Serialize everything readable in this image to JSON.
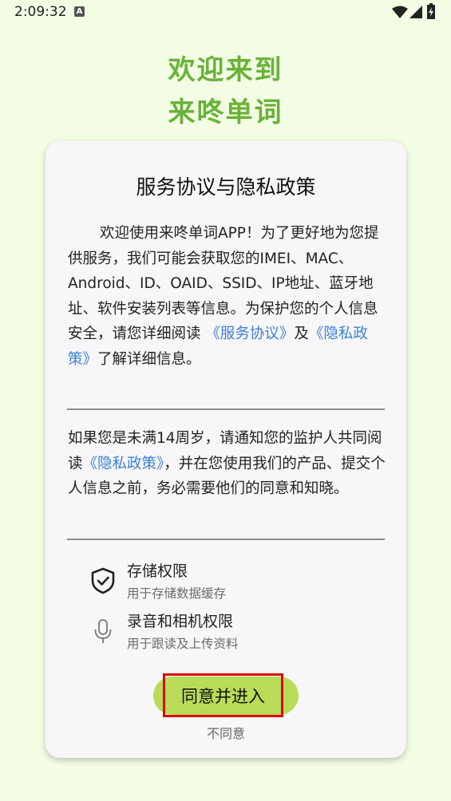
{
  "status_bar": {
    "time": "2:09:32",
    "notification_icon": "A",
    "icons": [
      "wifi-icon",
      "signal-icon",
      "battery-charging-icon"
    ]
  },
  "welcome": {
    "line1": "欢迎来到",
    "line2": "来咚单词"
  },
  "dialog": {
    "title": "服务协议与隐私政策",
    "para1": {
      "text_a": "欢迎使用来咚单词APP！为了更好地为您提供服务，我们可能会获取您的IMEI、MAC、Android、ID、OAID、SSID、IP地址、蓝牙地址、软件安装列表等信息。为保护您的个人信息安全，请您详细阅读 ",
      "link1": "《服务协议》",
      "text_b": "及",
      "link2": "《隐私政策》",
      "text_c": "了解详细信息。"
    },
    "para2": {
      "text_a": "如果您是未满14周岁，请通知您的监护人共同阅读",
      "link": "《隐私政策》",
      "text_b": "，并在您使用我们的产品、提交个人信息之前，务必需要他们的同意和知晓。"
    },
    "permissions": [
      {
        "icon": "shield-check-icon",
        "name": "存储权限",
        "desc": "用于存储数据缓存"
      },
      {
        "icon": "microphone-icon",
        "name": "录音和相机权限",
        "desc": "用于跟读及上传资料"
      }
    ],
    "agree_label": "同意并进入",
    "disagree_label": "不同意"
  },
  "colors": {
    "background": "#f3fde4",
    "accent_green": "#6ab23a",
    "button_green": "#b9dc58",
    "link_blue": "#3b82d6",
    "highlight_red": "#e00000"
  }
}
